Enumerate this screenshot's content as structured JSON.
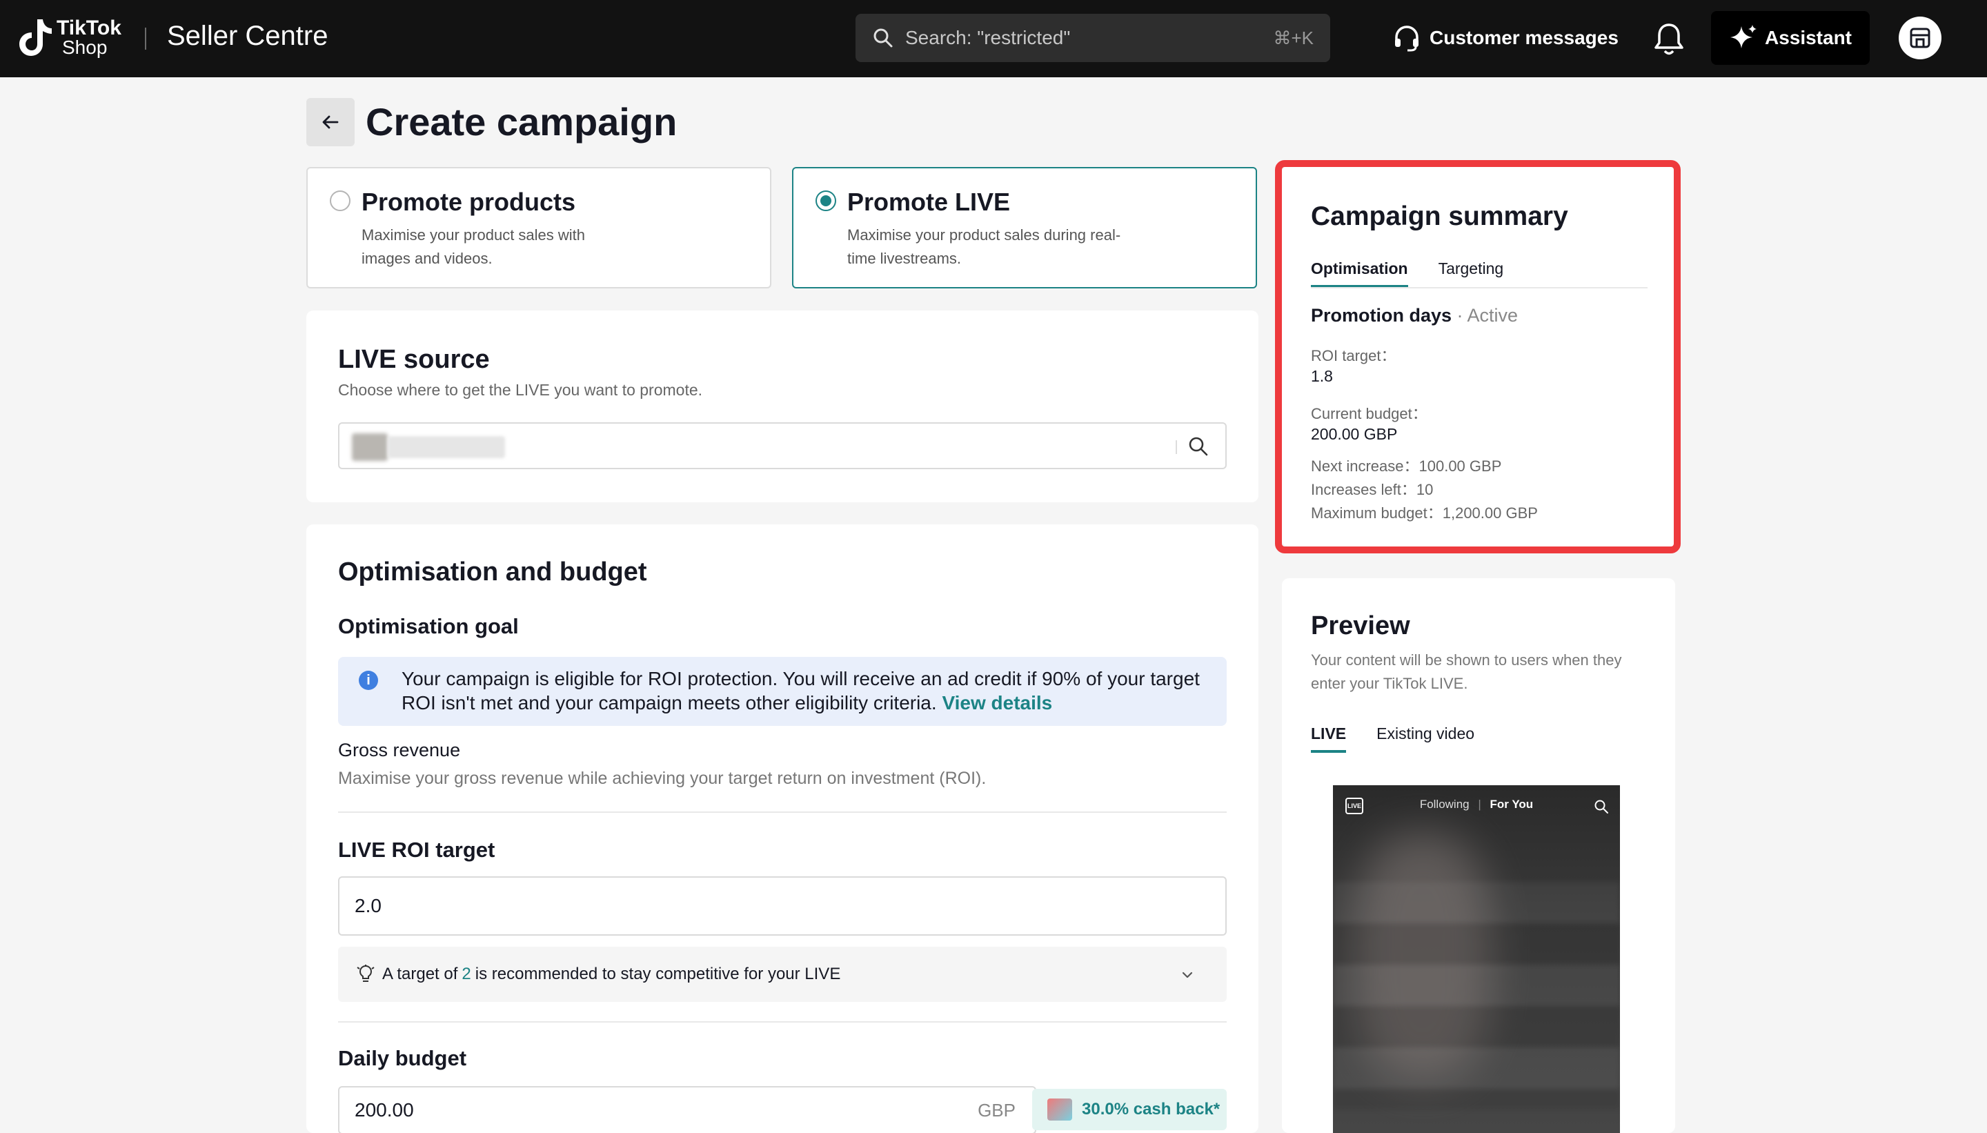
{
  "topbar": {
    "brand_line1": "TikTok",
    "brand_line2": "Shop",
    "app_title": "Seller Centre",
    "search_placeholder": "Search: \"restricted\"",
    "search_shortcut": "⌘+K",
    "customer_messages": "Customer messages",
    "assistant": "Assistant",
    "icons": [
      "tiktok-logo",
      "search-icon",
      "headset-icon",
      "bell-icon",
      "sparkle-icon",
      "store-icon"
    ]
  },
  "header": {
    "title": "Create campaign"
  },
  "promote": {
    "products": {
      "title": "Promote products",
      "desc": "Maximise your product sales with images and videos.",
      "selected": false
    },
    "live": {
      "title": "Promote LIVE",
      "desc": "Maximise your product sales during real-time livestreams.",
      "selected": true
    }
  },
  "live_source": {
    "title": "LIVE source",
    "subtitle": "Choose where to get the LIVE you want to promote."
  },
  "optimisation": {
    "title": "Optimisation and budget",
    "goal_label": "Optimisation goal",
    "info_text": "Your campaign is eligible for ROI protection. You will receive an ad credit if 90% of your target ROI isn't met and your campaign meets other eligibility criteria.",
    "info_link": "View details",
    "goal_name": "Gross revenue",
    "goal_desc": "Maximise your gross revenue while achieving your target return on investment (ROI).",
    "roi_label": "LIVE ROI target",
    "roi_value": "2.0",
    "rec_prefix": "A target of",
    "rec_value": "2",
    "rec_suffix": "is recommended to stay competitive for your LIVE",
    "budget_label": "Daily budget",
    "budget_value": "200.00",
    "budget_currency": "GBP",
    "cashback": "30.0% cash back*"
  },
  "summary": {
    "title": "Campaign summary",
    "tabs": [
      "Optimisation",
      "Targeting"
    ],
    "promotion_days": "Promotion days",
    "status": "· Active",
    "roi_label": "ROI target：",
    "roi_value": "1.8",
    "budget_label": "Current budget：",
    "budget_value": "200.00 GBP",
    "next_increase": "Next increase：100.00 GBP",
    "increases_left": "Increases left：10",
    "max_budget": "Maximum budget：1,200.00 GBP"
  },
  "preview": {
    "title": "Preview",
    "desc": "Your content will be shown to users when they enter your TikTok LIVE.",
    "tabs": [
      "LIVE",
      "Existing video"
    ],
    "phone_following": "Following",
    "phone_foryou": "For You",
    "phone_live": "LIVE"
  },
  "colors": {
    "accent": "#1c8385",
    "highlight_frame": "#ee3a3d",
    "topbar": "#121212"
  }
}
